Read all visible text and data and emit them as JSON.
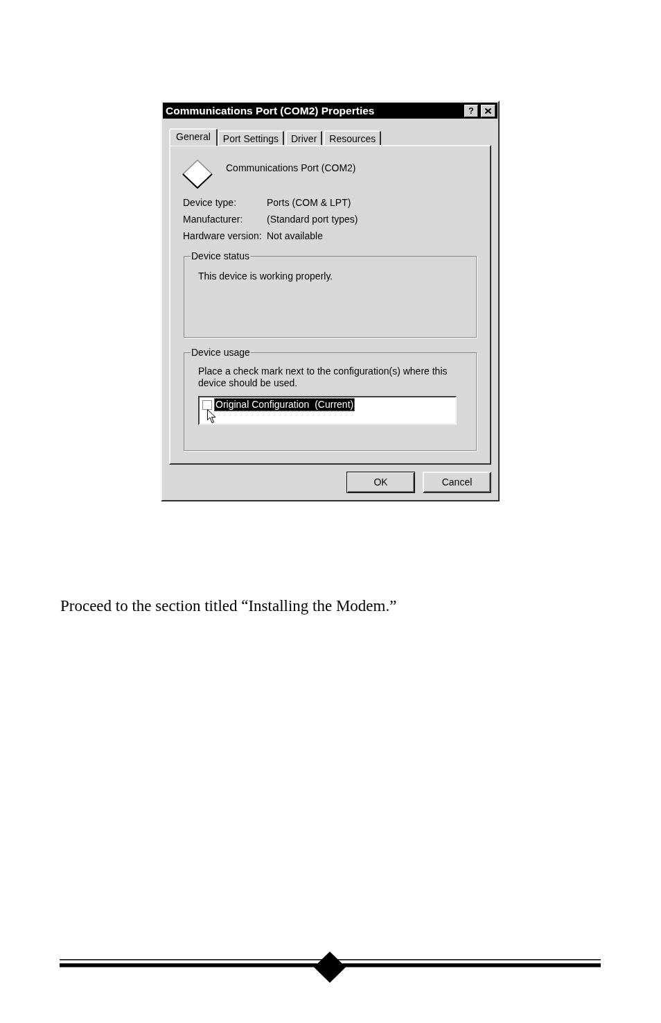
{
  "window": {
    "title": "Communications Port (COM2) Properties",
    "help_button": "?"
  },
  "tabs": [
    {
      "label": "General",
      "selected": true
    },
    {
      "label": "Port Settings",
      "selected": false
    },
    {
      "label": "Driver",
      "selected": false
    },
    {
      "label": "Resources",
      "selected": false
    }
  ],
  "device": {
    "name": "Communications Port (COM2)",
    "properties": [
      {
        "label": "Device type:",
        "value": "Ports (COM & LPT)"
      },
      {
        "label": "Manufacturer:",
        "value": "(Standard port types)"
      },
      {
        "label": "Hardware version:",
        "value": "Not available"
      }
    ]
  },
  "device_status": {
    "title": "Device status",
    "message": "This device is working properly."
  },
  "device_usage": {
    "title": "Device usage",
    "instruction": "Place a check mark next to the configuration(s) where this device should be used.",
    "configurations": [
      {
        "label": "Original Configuration  (Current)",
        "checked": false,
        "selected": true
      }
    ]
  },
  "buttons": [
    {
      "label": "OK",
      "default": true
    },
    {
      "label": "Cancel",
      "default": false
    }
  ],
  "caption": "Proceed to the section titled “Installing the Modem.”"
}
